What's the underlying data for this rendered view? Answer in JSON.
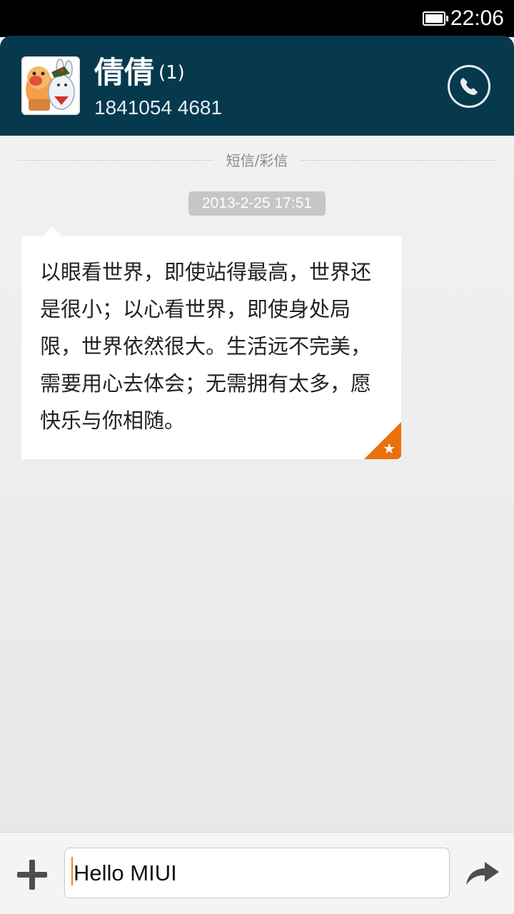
{
  "status_bar": {
    "time": "22:06",
    "battery_icon": "battery-full-icon"
  },
  "header": {
    "contact_name": "倩倩",
    "unread_count": "(1)",
    "phone_number": "1841054 4681",
    "call_icon": "phone-icon",
    "background_color": "#06394e"
  },
  "conversation": {
    "divider_label": "短信/彩信",
    "messages": [
      {
        "timestamp": "2013-2-25 17:51",
        "text": "以眼看世界，即使站得最高，世界还是很小；以心看世界，即使身处局限，世界依然很大。生活远不完美，需要用心去体会；无需拥有太多，愿快乐与你相随。",
        "starred": true,
        "star_color": "#e8710c"
      }
    ]
  },
  "composer": {
    "input_value": "Hello MIUI",
    "add_icon": "plus-icon",
    "send_icon": "send-arrow-icon"
  }
}
